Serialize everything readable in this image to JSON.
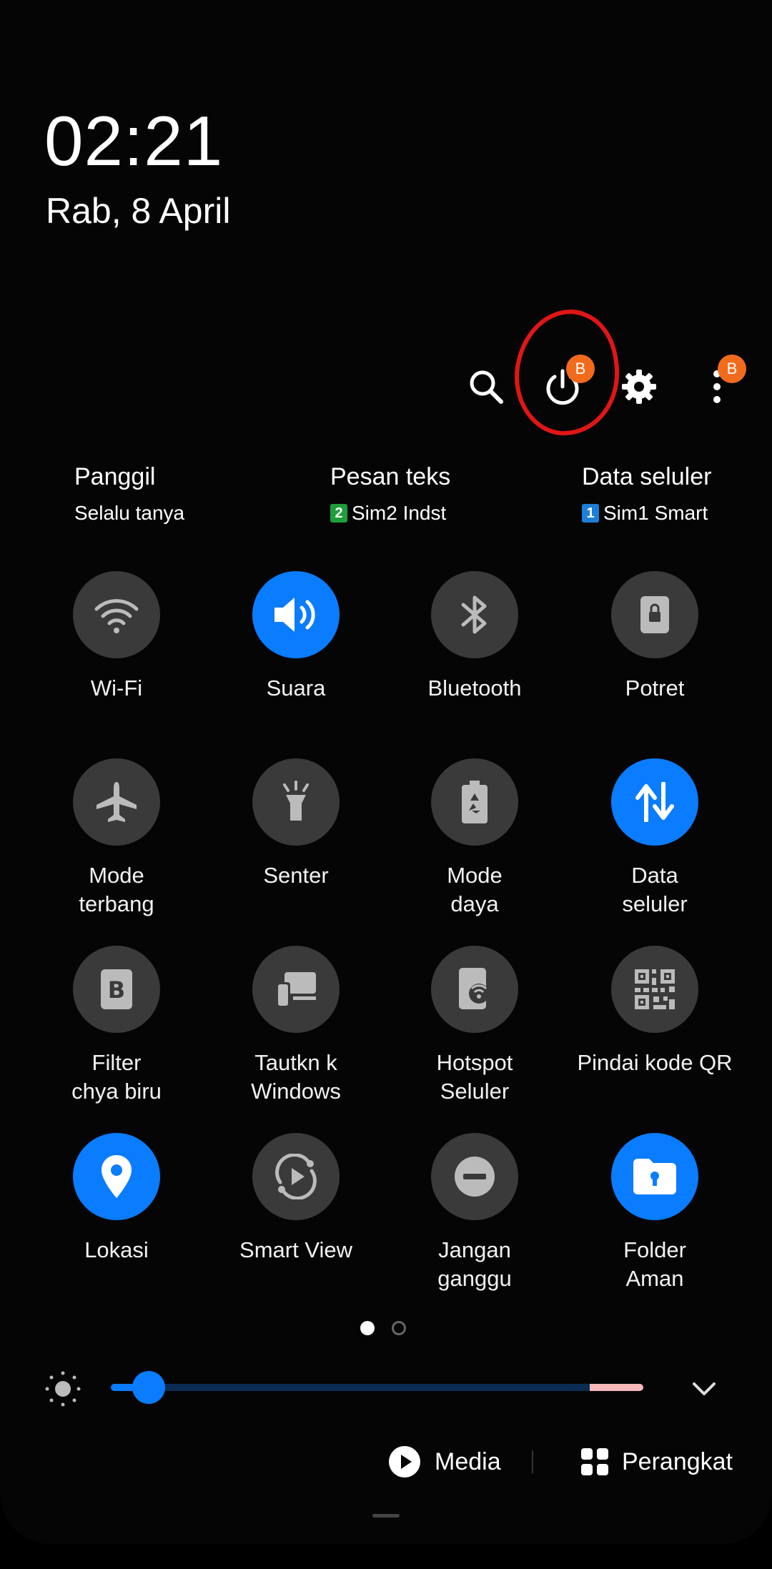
{
  "status": {
    "time": "02:21",
    "date": "Rab, 8 April"
  },
  "header_icons": {
    "search": "search-icon",
    "power": "power-icon",
    "power_badge": "B",
    "settings": "gear-icon",
    "more": "more-vert-icon",
    "more_badge": "B",
    "annotation_color": "#e01616"
  },
  "sim_prefs": [
    {
      "title": "Panggil",
      "subtitle": "Selalu tanya",
      "sim_number": "",
      "sim_color": ""
    },
    {
      "title": "Pesan teks",
      "subtitle": "Sim2 Indst",
      "sim_number": "2",
      "sim_color": "#1e9e3a"
    },
    {
      "title": "Data seluler",
      "subtitle": "Sim1 Smart",
      "sim_number": "1",
      "sim_color": "#1d7fd6"
    }
  ],
  "tiles": [
    {
      "label": "Wi-Fi",
      "icon": "wifi-icon",
      "active": false
    },
    {
      "label": "Suara",
      "icon": "volume-icon",
      "active": true
    },
    {
      "label": "Bluetooth",
      "icon": "bluetooth-icon",
      "active": false
    },
    {
      "label": "Potret",
      "icon": "portrait-lock-icon",
      "active": false
    },
    {
      "label": "Mode\nterbang",
      "icon": "airplane-icon",
      "active": false
    },
    {
      "label": "Senter",
      "icon": "flashlight-icon",
      "active": false
    },
    {
      "label": "Mode\ndaya",
      "icon": "battery-saver-icon",
      "active": false
    },
    {
      "label": "Data\nseluler",
      "icon": "mobile-data-icon",
      "active": true
    },
    {
      "label": "Filter\nchya biru",
      "icon": "blue-light-filter-icon",
      "active": false
    },
    {
      "label": "Tautkn k\nWindows",
      "icon": "link-windows-icon",
      "active": false
    },
    {
      "label": "Hotspot\nSeluler",
      "icon": "hotspot-icon",
      "active": false
    },
    {
      "label": "Pindai kode QR",
      "icon": "qr-code-icon",
      "active": false
    },
    {
      "label": "Lokasi",
      "icon": "location-icon",
      "active": true
    },
    {
      "label": "Smart View",
      "icon": "smart-view-icon",
      "active": false
    },
    {
      "label": "Jangan\nganggu",
      "icon": "do-not-disturb-icon",
      "active": false
    },
    {
      "label": "Folder\nAman",
      "icon": "secure-folder-icon",
      "active": true
    }
  ],
  "page_indicator": {
    "current": 1,
    "total": 2
  },
  "brightness": {
    "level": 0.06,
    "icon": "brightness-icon"
  },
  "bottom": {
    "media_label": "Media",
    "devices_label": "Perangkat"
  },
  "colors": {
    "accent": "#0a7cff",
    "tile_off": "#3a3a3a",
    "badge": "#f26b1d"
  }
}
